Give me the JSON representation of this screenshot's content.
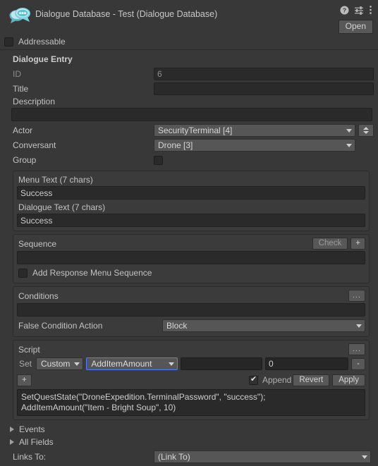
{
  "header": {
    "title": "Dialogue Database - Test (Dialogue Database)",
    "icon": "dialogue-database-icon",
    "help_icon": "help-icon",
    "preset_icon": "preset-settings-icon",
    "menu_icon": "kebab-menu-icon",
    "open_label": "Open"
  },
  "addressable": {
    "label": "Addressable",
    "checked": false
  },
  "dialogue_entry": {
    "section_title": "Dialogue Entry",
    "id_label": "ID",
    "id_value": "6",
    "title_label": "Title",
    "title_value": "",
    "description_label": "Description",
    "description_value": "",
    "actor_label": "Actor",
    "actor_value": "SecurityTerminal [4]",
    "conversant_label": "Conversant",
    "conversant_value": "Drone [3]",
    "group_label": "Group",
    "group_checked": false
  },
  "text_panel": {
    "menu_text_label": "Menu Text (7 chars)",
    "menu_text_value": "Success",
    "dialogue_text_label": "Dialogue Text (7 chars)",
    "dialogue_text_value": "Success"
  },
  "sequence_panel": {
    "title": "Sequence",
    "check_label": "Check",
    "add_label": "+",
    "value": "",
    "response_menu_label": "Add Response Menu Sequence",
    "response_menu_checked": false
  },
  "conditions_panel": {
    "title": "Conditions",
    "menu_label": "...",
    "value": "",
    "false_action_label": "False Condition Action",
    "false_action_value": "Block"
  },
  "script_panel": {
    "title": "Script",
    "menu_label": "...",
    "set_label": "Set",
    "custom_value": "Custom",
    "action_value": "AddItemAmount",
    "arg_value": "",
    "number_value": "0",
    "minus_label": "-",
    "plus_label": "+",
    "append_label": "Append",
    "append_checked": true,
    "revert_label": "Revert",
    "apply_label": "Apply",
    "code": "SetQuestState(\"DroneExpedition.TerminalPassword\", \"success\");\nAddItemAmount(\"Item - Bright Soup\", 10)"
  },
  "footer": {
    "events_label": "Events",
    "all_fields_label": "All Fields",
    "links_to_label": "Links To:",
    "links_to_value": "(Link To)"
  },
  "colors": {
    "background": "#383838",
    "panel": "#3b3b3b",
    "field": "#2a2a2a",
    "dropdown": "#565656",
    "accent_focus": "#4c7eff",
    "icon_teal": "#6fc9d8"
  }
}
